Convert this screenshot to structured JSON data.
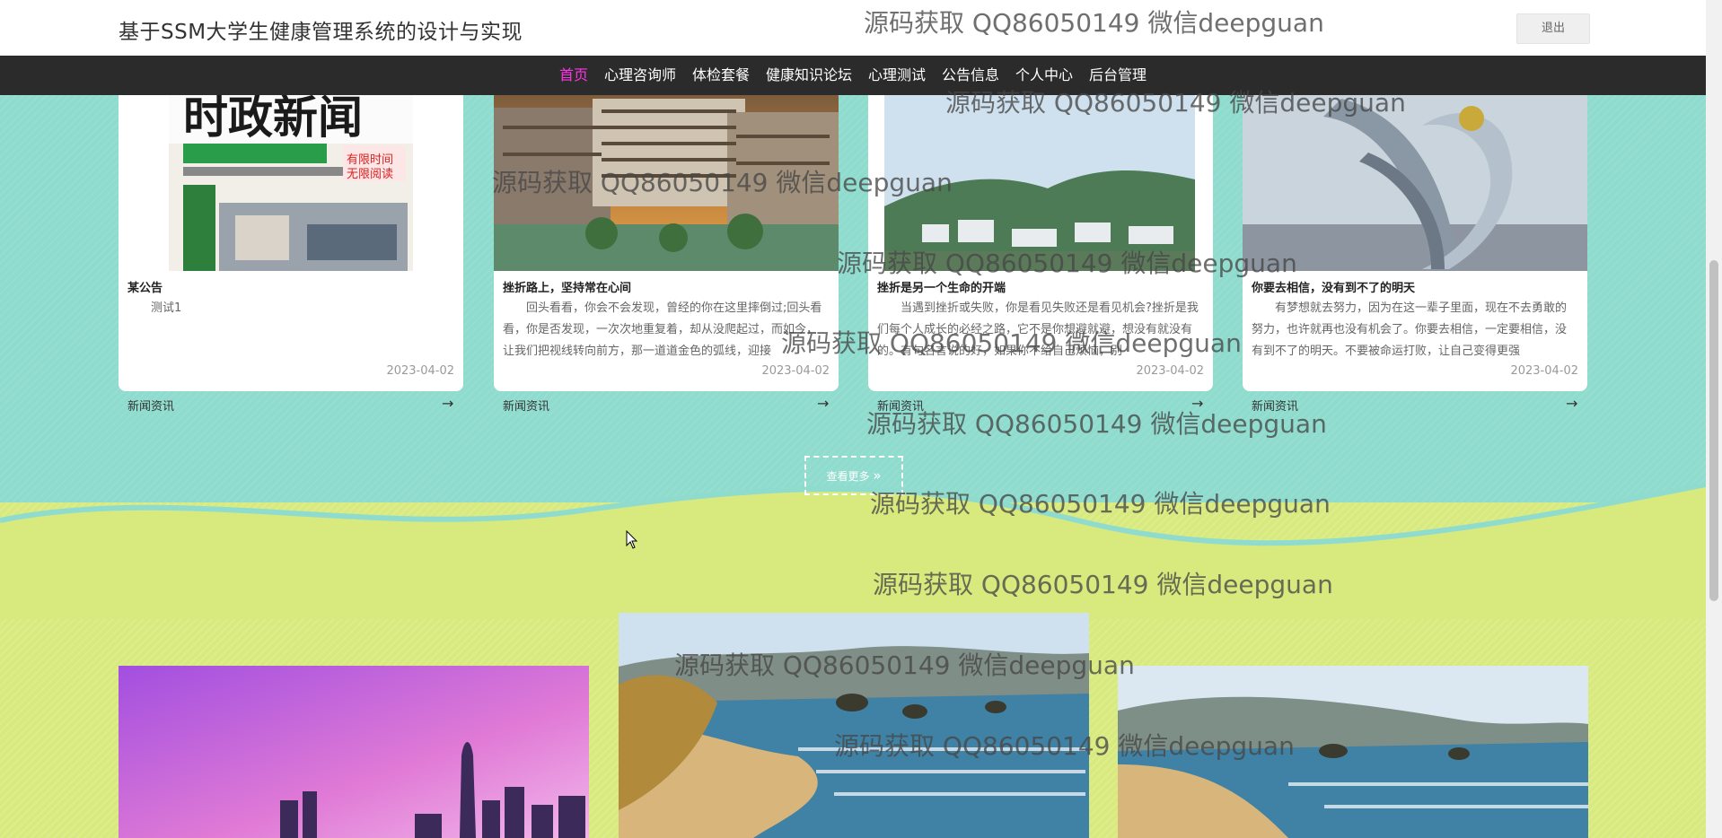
{
  "header": {
    "title": "基于SSM大学生健康管理系统的设计与实现",
    "logout_label": "退出"
  },
  "nav": {
    "items": [
      "首页",
      "心理咨询师",
      "体检套餐",
      "健康知识论坛",
      "心理测试",
      "公告信息",
      "个人中心",
      "后台管理"
    ],
    "active_index": 0,
    "active_color": "#ff34e7"
  },
  "news": {
    "cards": [
      {
        "title": "某公告",
        "text": "测试1",
        "date": "2023-04-02",
        "category": "新闻资讯",
        "arrow": "→",
        "image": "newspaper-cover"
      },
      {
        "title": "挫折路上，坚持常在心间",
        "text": "回头看看，你会不会发现，曾经的你在这里摔倒过;回头看看，你是否发现，一次次地重复着，却从没爬起过，而如今，让我们把视线转向前方，那一道道金色的弧线，迎接",
        "date": "2023-04-02",
        "category": "新闻资讯",
        "arrow": "→",
        "image": "campus-building"
      },
      {
        "title": "挫折是另一个生命的开端",
        "text": "当遇到挫折或失败，你是看见失败还是看见机会?挫折是我们每个人成长的必经之路，它不是你想避就避，想没有就没有的。有句名言说的好，如果你不给自己烦恼，别",
        "date": "2023-04-02",
        "category": "新闻资讯",
        "arrow": "→",
        "image": "city-hills"
      },
      {
        "title": "你要去相信，没有到不了的明天",
        "text": "有梦想就去努力，因为在这一辈子里面，现在不去勇敢的努力，也许就再也没有机会了。你要去相信，一定要相信，没有到不了的明天。不要被命运打败，让自己变得更强",
        "date": "2023-04-02",
        "category": "新闻资讯",
        "arrow": "→",
        "image": "sculpture"
      }
    ],
    "more_label": "查看更多"
  },
  "gallery": {
    "images": [
      "city-skyline-purple",
      "coast-beach",
      "coast-beach"
    ]
  },
  "watermark": {
    "text": "源码获取 QQ86050149 微信deepguan"
  },
  "colors": {
    "navbar": "#2b2b2b",
    "teal_section": "#8fdcce",
    "yellow_section": "#d8ea7e"
  }
}
